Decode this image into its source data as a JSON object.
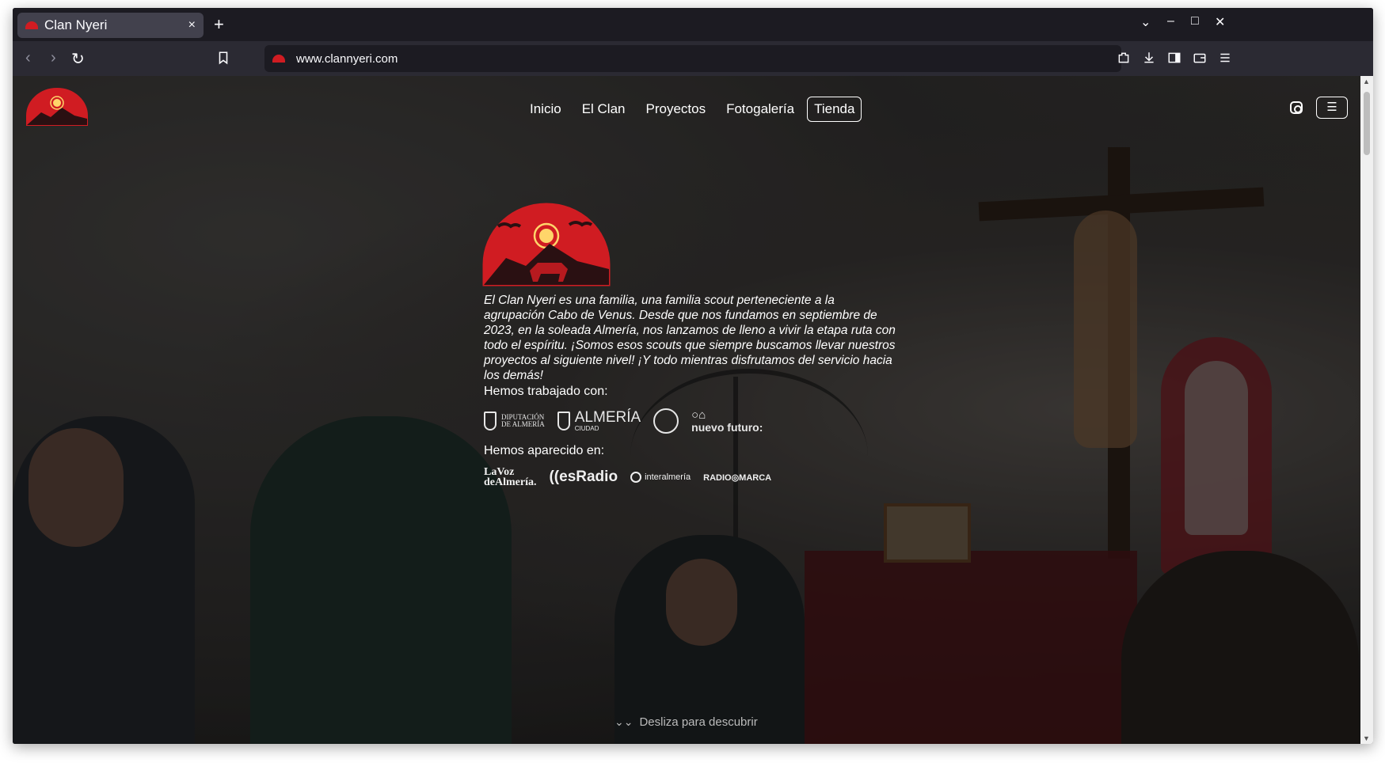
{
  "browser": {
    "tab_title": "Clan Nyeri",
    "tab_close": "×",
    "new_tab": "+",
    "url": "www.clannyeri.com",
    "controls": {
      "list": "⌄",
      "minimize": "–",
      "maximize": "□",
      "close": "✕"
    },
    "nav": {
      "back": "‹",
      "forward": "›",
      "reload": "↻"
    }
  },
  "site": {
    "menu": [
      {
        "label": "Inicio"
      },
      {
        "label": "El Clan"
      },
      {
        "label": "Proyectos"
      },
      {
        "label": "Fotogalería"
      },
      {
        "label": "Tienda"
      }
    ],
    "menu_toggle": "☰",
    "brand_colors": {
      "red": "#d01c22",
      "dark": "#2a1012",
      "sun": "#ffd56a"
    }
  },
  "hero": {
    "intro": "El Clan Nyeri es una familia, una familia scout perteneciente a la agrupación Cabo de Venus. Desde que nos fundamos en septiembre de 2023, en la soleada Almería, nos lanzamos de lleno a vivir la etapa ruta con todo el espíritu. ¡Somos esos scouts que siempre buscamos llevar nuestros proyectos al siguiente nivel! ¡Y todo mientras disfrutamos del servicio hacia los demás!",
    "worked_with_label": "Hemos trabajado con:",
    "partners": {
      "diputacion_line1": "DIPUTACIÓN",
      "diputacion_line2": "DE ALMERÍA",
      "almeria_big": "ALMERÍA",
      "almeria_sub": "CIUDAD",
      "nuevo_futuro": "nuevo futuro:"
    },
    "appeared_label": "Hemos aparecido en:",
    "media": {
      "lavoz_line1": "LaVoz",
      "lavoz_line2": "deAlmería.",
      "esradio": "((esRadio",
      "interalmeria": "interalmería",
      "radiomarca": "RADIO◎MARCA"
    },
    "scroll_hint": "Desliza para descubrir"
  }
}
